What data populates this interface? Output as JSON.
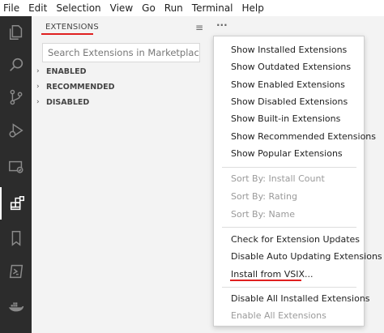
{
  "menubar": [
    "File",
    "Edit",
    "Selection",
    "View",
    "Go",
    "Run",
    "Terminal",
    "Help"
  ],
  "sidebar": {
    "title": "EXTENSIONS",
    "search_placeholder": "Search Extensions in Marketplace",
    "more_glyph": "···",
    "filter_glyph": "≡",
    "sections": [
      {
        "label": "ENABLED",
        "chevron": "›"
      },
      {
        "label": "RECOMMENDED",
        "chevron": "›"
      },
      {
        "label": "DISABLED",
        "chevron": "›"
      }
    ]
  },
  "activity_icons": [
    "explorer-icon",
    "search-icon",
    "source-control-icon",
    "run-debug-icon",
    "remote-explorer-icon",
    "extensions-icon",
    "bookmark-icon",
    "powershell-icon",
    "docker-icon"
  ],
  "context_menu": {
    "groups": [
      [
        {
          "label": "Show Installed Extensions",
          "enabled": true
        },
        {
          "label": "Show Outdated Extensions",
          "enabled": true
        },
        {
          "label": "Show Enabled Extensions",
          "enabled": true
        },
        {
          "label": "Show Disabled Extensions",
          "enabled": true
        },
        {
          "label": "Show Built-in Extensions",
          "enabled": true
        },
        {
          "label": "Show Recommended Extensions",
          "enabled": true
        },
        {
          "label": "Show Popular Extensions",
          "enabled": true
        }
      ],
      [
        {
          "label": "Sort By: Install Count",
          "enabled": false
        },
        {
          "label": "Sort By: Rating",
          "enabled": false
        },
        {
          "label": "Sort By: Name",
          "enabled": false
        }
      ],
      [
        {
          "label": "Check for Extension Updates",
          "enabled": true
        },
        {
          "label": "Disable Auto Updating Extensions",
          "enabled": true
        },
        {
          "label": "Install from VSIX...",
          "enabled": true
        }
      ],
      [
        {
          "label": "Disable All Installed Extensions",
          "enabled": true
        },
        {
          "label": "Enable All Extensions",
          "enabled": false
        }
      ]
    ]
  },
  "colors": {
    "annotation_underline": "#e02020",
    "activity_bar": "#2c2c2c"
  }
}
